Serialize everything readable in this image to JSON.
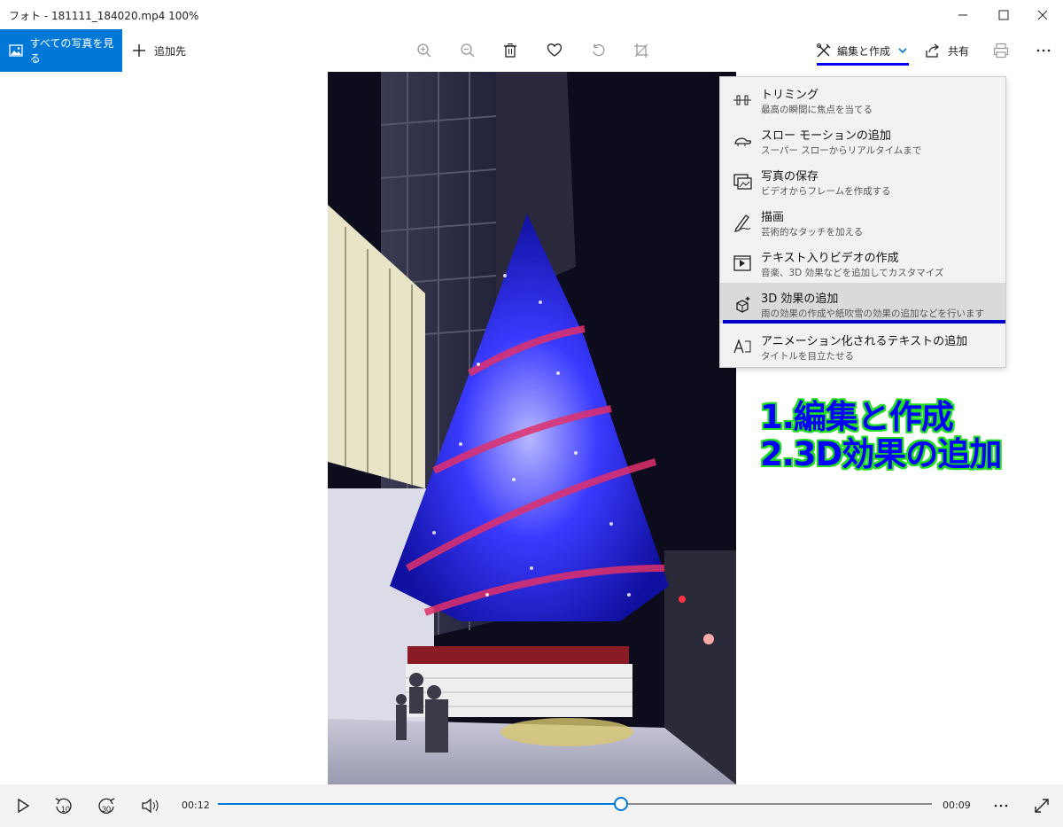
{
  "window": {
    "title": "フォト - 181111_184020.mp4   100%"
  },
  "toolbar": {
    "all_photos_label": "すべての写真を見る",
    "add_to_label": "追加先",
    "edit_create_label": "編集と作成",
    "share_label": "共有"
  },
  "menu": {
    "items": [
      {
        "title": "トリミング",
        "subtitle": "最高の瞬間に焦点を当てる",
        "icon": "trim-icon"
      },
      {
        "title": "スロー モーションの追加",
        "subtitle": "スーパー スローからリアルタイムまで",
        "icon": "turtle-icon"
      },
      {
        "title": "写真の保存",
        "subtitle": "ビデオからフレームを作成する",
        "icon": "save-photo-icon"
      },
      {
        "title": "描画",
        "subtitle": "芸術的なタッチを加える",
        "icon": "pen-icon"
      },
      {
        "title": "テキスト入りビデオの作成",
        "subtitle": "音楽、3D 効果などを追加してカスタマイズ",
        "icon": "video-text-icon"
      },
      {
        "title": "3D 効果の追加",
        "subtitle": "雨の効果の作成や紙吹雪の効果の追加などを行います",
        "icon": "3d-effects-icon"
      },
      {
        "title": "アニメーション化されるテキストの追加",
        "subtitle": "タイトルを目立たせる",
        "icon": "animated-text-icon"
      }
    ],
    "selected_index": 5
  },
  "annotation": {
    "line1": "1.編集と作成",
    "line2": "2.3D効果の追加",
    "text_color": "#0000ff",
    "outline_color": "#22dd22"
  },
  "player": {
    "elapsed": "00:12",
    "remaining": "00:09",
    "skip_back_label": "10",
    "skip_forward_label": "30",
    "progress_fraction": 0.565
  },
  "colors": {
    "accent": "#0078d7",
    "highlight_underline": "#0000cc"
  }
}
